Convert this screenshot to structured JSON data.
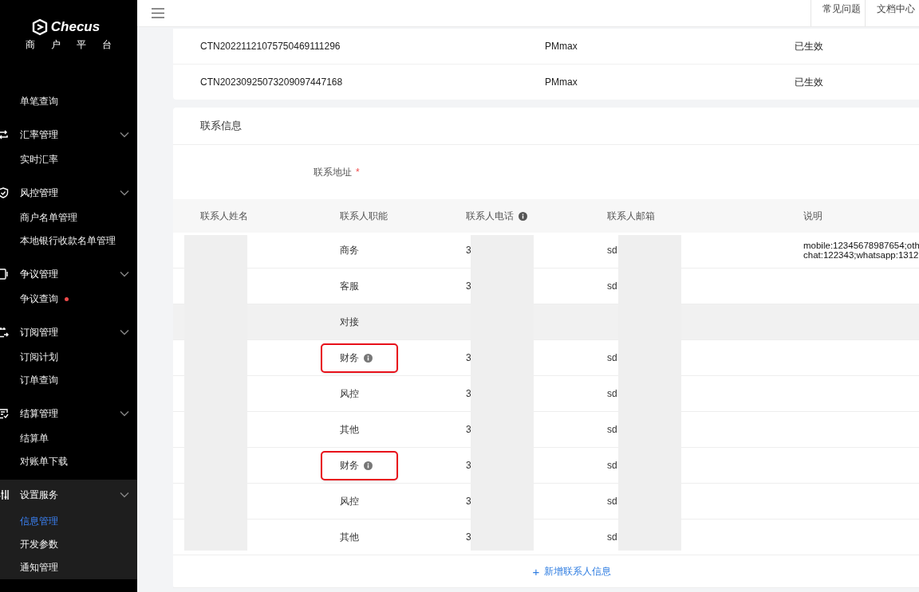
{
  "sidebar": {
    "logo": "Checus",
    "subtitle": "商户平台",
    "menu": [
      {
        "kind": "item",
        "label": "单笔查询",
        "selected": false,
        "dot": false
      },
      {
        "kind": "group",
        "label": "汇率管理",
        "expanded": true,
        "active": false
      },
      {
        "kind": "item",
        "label": "实时汇率",
        "selected": false,
        "dot": false
      },
      {
        "kind": "group",
        "label": "风控管理",
        "expanded": true,
        "active": false
      },
      {
        "kind": "item",
        "label": "商户名单管理",
        "selected": false,
        "dot": false
      },
      {
        "kind": "item",
        "label": "本地银行收款名单管理",
        "selected": false,
        "dot": false
      },
      {
        "kind": "group",
        "label": "争议管理",
        "expanded": true,
        "active": false
      },
      {
        "kind": "item",
        "label": "争议查询",
        "selected": false,
        "dot": true
      },
      {
        "kind": "group",
        "label": "订阅管理",
        "expanded": true,
        "active": false
      },
      {
        "kind": "item",
        "label": "订阅计划",
        "selected": false,
        "dot": false
      },
      {
        "kind": "item",
        "label": "订单查询",
        "selected": false,
        "dot": false
      },
      {
        "kind": "group",
        "label": "结算管理",
        "expanded": true,
        "active": false
      },
      {
        "kind": "item",
        "label": "结算单",
        "selected": false,
        "dot": false
      },
      {
        "kind": "item",
        "label": "对账单下载",
        "selected": false,
        "dot": false
      },
      {
        "kind": "group",
        "label": "设置服务",
        "expanded": true,
        "active": true
      },
      {
        "kind": "item",
        "label": "信息管理",
        "selected": true,
        "dot": false
      },
      {
        "kind": "item",
        "label": "开发参数",
        "selected": false,
        "dot": false
      },
      {
        "kind": "item",
        "label": "通知管理",
        "selected": false,
        "dot": false
      }
    ]
  },
  "header": {
    "links": [
      "常见问题",
      "文档中心"
    ]
  },
  "products": {
    "rows": [
      [
        "CTN20221121075750469111296",
        "PMmax",
        "已生效"
      ],
      [
        "CTN20230925073209097447168",
        "PMmax",
        "已生效"
      ]
    ]
  },
  "contact": {
    "title": "联系信息",
    "address_label": "联系地址",
    "required_mark": "*",
    "columns": [
      {
        "label": "联系人姓名",
        "info": false
      },
      {
        "label": "联系人职能",
        "info": false
      },
      {
        "label": "联系人电话",
        "info": true
      },
      {
        "label": "联系人邮箱",
        "info": false
      },
      {
        "label": "说明",
        "info": false
      }
    ],
    "rows": [
      {
        "role": "商务",
        "info": false,
        "annotated": false,
        "highlighted": false,
        "phone": "3",
        "email": "sd",
        "note": [
          "mobile:12345678987654;oth",
          "chat:122343;whatsapp:1312"
        ]
      },
      {
        "role": "客服",
        "info": false,
        "annotated": false,
        "highlighted": false,
        "phone": "3",
        "email": "sd",
        "note": []
      },
      {
        "role": "对接",
        "info": false,
        "annotated": false,
        "highlighted": true,
        "phone": "",
        "email": "",
        "note": []
      },
      {
        "role": "财务",
        "info": true,
        "annotated": true,
        "highlighted": false,
        "phone": "3",
        "email": "sd",
        "note": []
      },
      {
        "role": "风控",
        "info": false,
        "annotated": false,
        "highlighted": false,
        "phone": "3",
        "email": "sd",
        "note": []
      },
      {
        "role": "其他",
        "info": false,
        "annotated": false,
        "highlighted": false,
        "phone": "3",
        "email": "sd",
        "note": []
      },
      {
        "role": "财务",
        "info": true,
        "annotated": true,
        "highlighted": false,
        "phone": "3",
        "email": "sd",
        "note": []
      },
      {
        "role": "风控",
        "info": false,
        "annotated": false,
        "highlighted": false,
        "phone": "3",
        "email": "sd",
        "note": []
      },
      {
        "role": "其他",
        "info": false,
        "annotated": false,
        "highlighted": false,
        "phone": "3",
        "email": "sd",
        "note": []
      }
    ],
    "add_button": {
      "icon": "+",
      "label": "新增联系人信息"
    }
  }
}
